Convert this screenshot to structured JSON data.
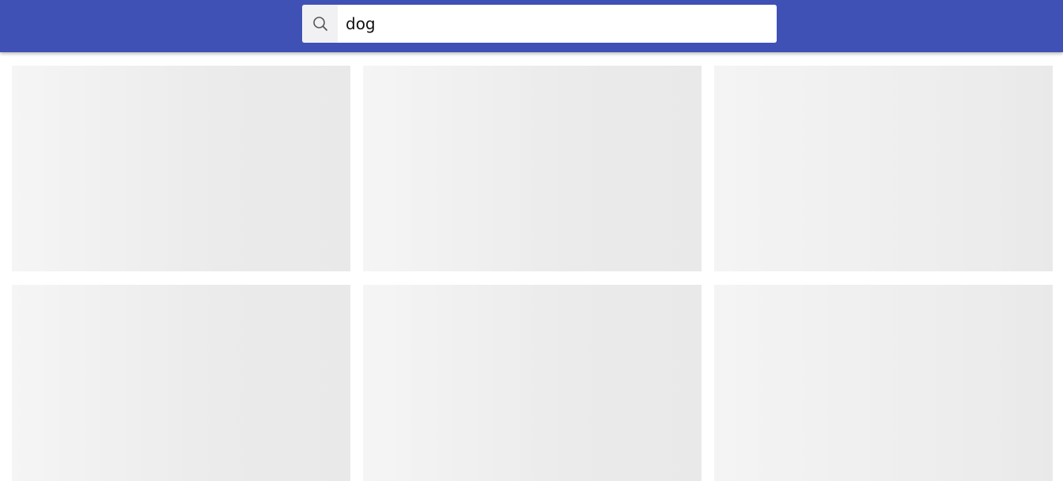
{
  "header": {
    "color": "#3f51b5"
  },
  "search": {
    "icon": "search-icon",
    "value": "dog",
    "placeholder": ""
  },
  "results": {
    "state": "loading-skeleton",
    "placeholder_color": "#ebebeb",
    "rows": [
      [
        "skeleton",
        "skeleton",
        "skeleton"
      ],
      [
        "skeleton",
        "skeleton",
        "skeleton"
      ],
      [
        "skeleton",
        "skeleton",
        "skeleton"
      ]
    ]
  }
}
